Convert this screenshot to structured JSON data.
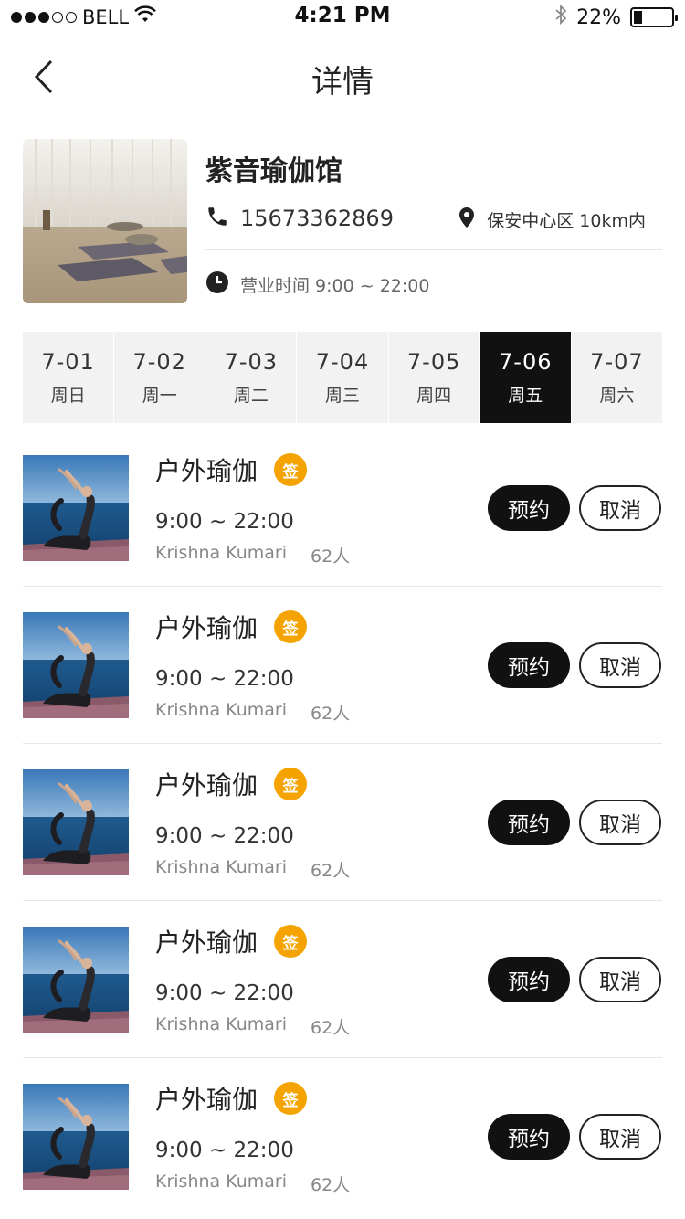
{
  "status_bar": {
    "carrier": "BELL",
    "time": "4:21 PM",
    "battery": "22%",
    "battery_level": 0.22,
    "icons": [
      "signal-dots-icon",
      "wifi-icon",
      "bluetooth-icon",
      "battery-icon"
    ]
  },
  "nav": {
    "title": "详情",
    "back_icon": "chevron-left-icon"
  },
  "venue": {
    "name": "紫音瑜伽馆",
    "phone": "15673362869",
    "location": "保安中心区 10km内",
    "hours_label": "营业时间 9:00 ~ 22:00",
    "icons": [
      "phone-icon",
      "location-pin-icon",
      "clock-icon"
    ]
  },
  "dates": [
    {
      "date": "7-01",
      "weekday": "周日",
      "active": false
    },
    {
      "date": "7-02",
      "weekday": "周一",
      "active": false
    },
    {
      "date": "7-03",
      "weekday": "周二",
      "active": false
    },
    {
      "date": "7-04",
      "weekday": "周三",
      "active": false
    },
    {
      "date": "7-05",
      "weekday": "周四",
      "active": false
    },
    {
      "date": "7-06",
      "weekday": "周五",
      "active": true
    },
    {
      "date": "7-07",
      "weekday": "周六",
      "active": false
    }
  ],
  "classes": [
    {
      "title": "户外瑜伽",
      "badge": "签",
      "time": "9:00 ~ 22:00",
      "instructor": "Krishna Kumari",
      "count": "62人",
      "book_label": "预约",
      "cancel_label": "取消"
    },
    {
      "title": "户外瑜伽",
      "badge": "签",
      "time": "9:00 ~ 22:00",
      "instructor": "Krishna Kumari",
      "count": "62人",
      "book_label": "预约",
      "cancel_label": "取消"
    },
    {
      "title": "户外瑜伽",
      "badge": "签",
      "time": "9:00 ~ 22:00",
      "instructor": "Krishna Kumari",
      "count": "62人",
      "book_label": "预约",
      "cancel_label": "取消"
    },
    {
      "title": "户外瑜伽",
      "badge": "签",
      "time": "9:00 ~ 22:00",
      "instructor": "Krishna Kumari",
      "count": "62人",
      "book_label": "预约",
      "cancel_label": "取消"
    },
    {
      "title": "户外瑜伽",
      "badge": "签",
      "time": "9:00 ~ 22:00",
      "instructor": "Krishna Kumari",
      "count": "62人",
      "book_label": "预约",
      "cancel_label": "取消"
    }
  ],
  "colors": {
    "accent": "#111111",
    "badge": "#f5a300",
    "tab_bg": "#f2f2f2"
  }
}
